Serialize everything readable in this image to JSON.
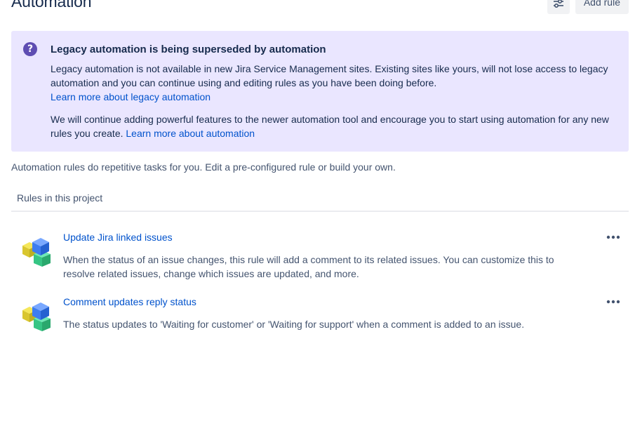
{
  "header": {
    "title": "Automation",
    "add_rule_label": "Add rule",
    "settings_icon": "sliders-icon"
  },
  "banner": {
    "icon": "question-icon",
    "icon_glyph": "?",
    "title": "Legacy automation is being superseded by automation",
    "paragraph1": "Legacy automation is not available in new Jira Service Management sites. Existing sites like yours, will not lose access to legacy automation and you can continue using and editing rules as you have been doing before.",
    "link1": "Learn more about legacy automation",
    "paragraph2": "We will continue adding powerful features to the newer automation tool and encourage you to start using automation for any new rules you create.",
    "link2": "Learn more about automation",
    "background": "#eae6ff",
    "accent": "#5e4db2"
  },
  "intro_text": "Automation rules do repetitive tasks for you. Edit a pre-configured rule or build your own.",
  "section_label": "Rules in this project",
  "rules": [
    {
      "title": "Update Jira linked issues",
      "description": "When the status of an issue changes, this rule will add a comment to its related issues. You can customize this to resolve related issues, change which issues are updated, and more."
    },
    {
      "title": "Comment updates reply status",
      "description": "The status updates to 'Waiting for customer' or 'Waiting for support' when a comment is added to an issue."
    }
  ],
  "colors": {
    "link": "#0052cc",
    "text": "#172b4d",
    "subtle_text": "#44546f"
  }
}
